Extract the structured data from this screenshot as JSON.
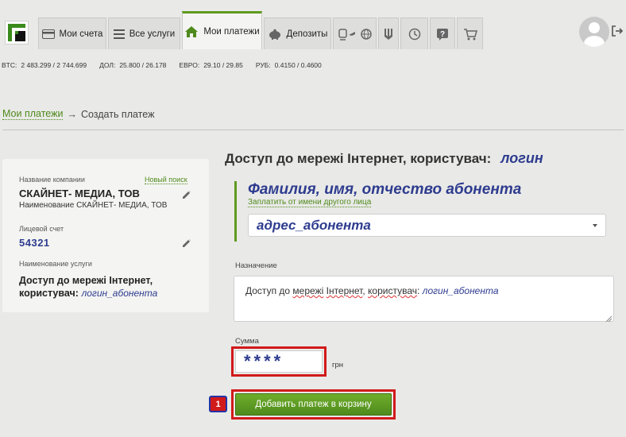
{
  "nav": {
    "tabs": [
      {
        "label": "Мои счета",
        "icon": "card-icon"
      },
      {
        "label": "Все услуги",
        "icon": "list-icon"
      },
      {
        "label": "Мои платежи",
        "icon": "home-icon",
        "active": true
      },
      {
        "label": "Депозиты",
        "icon": "piggy-bank-icon"
      }
    ],
    "icon_tabs": [
      "transport-icon",
      "globe-icon",
      "trident-icon",
      "history-icon",
      "help-icon",
      "cart-icon"
    ],
    "brand_color": "#5e9a1f"
  },
  "rates": [
    {
      "label": "BTC:",
      "value": "2 483.299 / 2 744.699"
    },
    {
      "label": "ДОЛ:",
      "value": "25.800 / 26.178"
    },
    {
      "label": "ЕВРО:",
      "value": "29.10 / 29.85"
    },
    {
      "label": "РУБ:",
      "value": "0.4150 / 0.4600"
    }
  ],
  "breadcrumb": {
    "link": "Мои платежи",
    "arrow": "→",
    "current": "Создать платеж"
  },
  "card": {
    "company_label": "Название компании",
    "new_search": "Новый поиск",
    "company_name": "СКАЙНЕТ- МЕДИА, ТОВ",
    "company_sub": "Наименование СКАЙНЕТ- МЕДИА, ТОВ",
    "account_label": "Лицевой счет",
    "account": "54321",
    "service_label": "Наименование услуги",
    "service_line1": "Доступ до мережі Інтернет,",
    "service_line2": "користувач:",
    "service_login": "логин_абонента"
  },
  "form": {
    "title": "Доступ до мережі Інтернет, користувач:",
    "title_login": "логин",
    "payer_name": "Фамилия, имя, отчество абонента",
    "pay_other": "Заплатить от имени другого лица",
    "address": "адрес_абонента",
    "purpose_label": "Назначение",
    "purpose_p1": "Доступ до ",
    "purpose_w1": "мережі",
    "purpose_p2": " ",
    "purpose_w2": "Інтернет",
    "purpose_p3": ", ",
    "purpose_w3": "користувач",
    "purpose_p4": ": ",
    "purpose_login": "логин_абонента",
    "sum_label": "Сумма",
    "sum_value": "****",
    "currency": "грн",
    "step_number": "1",
    "submit": "Добавить платеж в корзину"
  }
}
